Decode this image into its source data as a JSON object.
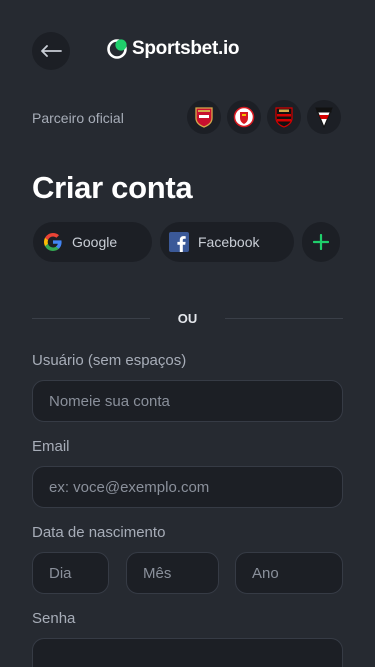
{
  "header": {
    "logo_text": "Sportsbet.io",
    "back_icon": "arrow-left-icon"
  },
  "partners": {
    "label": "Parceiro oficial",
    "crests": [
      "arsenal-crest-icon",
      "southampton-crest-icon",
      "flamengo-crest-icon",
      "sao-paulo-crest-icon"
    ]
  },
  "form": {
    "title": "Criar conta",
    "social": {
      "google_label": "Google",
      "facebook_label": "Facebook",
      "more_icon": "plus-icon"
    },
    "divider": "OU",
    "username": {
      "label": "Usuário (sem espaços)",
      "placeholder": "Nomeie sua conta",
      "value": ""
    },
    "email": {
      "label": "Email",
      "placeholder": "ex: voce@exemplo.com",
      "value": ""
    },
    "birthdate": {
      "label": "Data de nascimento",
      "day_placeholder": "Dia",
      "month_placeholder": "Mês",
      "year_placeholder": "Ano"
    },
    "password": {
      "label": "Senha",
      "placeholder": "",
      "value": ""
    }
  },
  "colors": {
    "background": "#262a31",
    "surface": "#1c1f25",
    "accent": "#1fcf6b",
    "muted_text": "#a7adb8"
  }
}
